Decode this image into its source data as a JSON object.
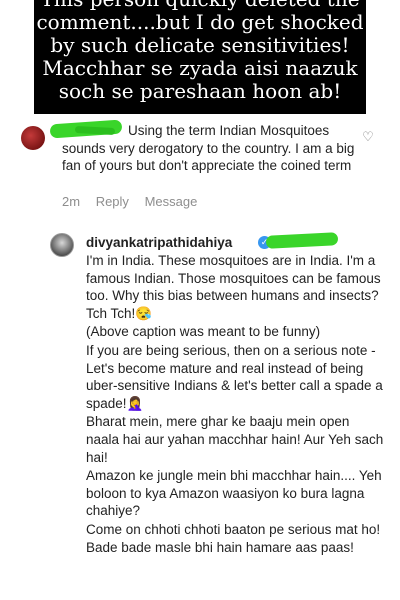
{
  "banner": {
    "lines": [
      "This person quickly deleted the",
      "comment....but I do get shocked",
      "by such delicate sensitivities!",
      "Macchhar se zyada aisi naazuk",
      "soch se pareshaan hoon ab!"
    ]
  },
  "comment": {
    "text": "Using the term Indian Mosquitoes sounds very derogatory to the country. I am a big fan of yours but don't appreciate the coined term",
    "age": "2m",
    "reply_label": "Reply",
    "message_label": "Message",
    "like_icon": "heart-icon"
  },
  "reply": {
    "username": "divyankatripathidahiya",
    "paragraphs": [
      "I'm in India. These mosquitoes are in India. I'm a famous Indian. Those mosquitoes can be famous too. Why this bias between humans and insects? Tch Tch!😪",
      "(Above caption was meant to be funny)",
      "If you are being serious, then on a serious note - Let's become mature and real instead of being uber-sensitive Indians & let's better call a spade a spade!🤦‍♀️",
      "Bharat mein, mere ghar ke baaju mein open naala hai aur yahan macchhar hain! Aur Yeh sach hai!",
      "Amazon ke jungle mein bhi macchhar hain.... Yeh boloon to kya Amazon waasiyon ko bura lagna chahiye?",
      "Come on chhoti chhoti baaton pe serious mat ho! Bade bade masle bhi hain hamare aas paas!"
    ],
    "verified_icon": "verified-badge-icon"
  }
}
